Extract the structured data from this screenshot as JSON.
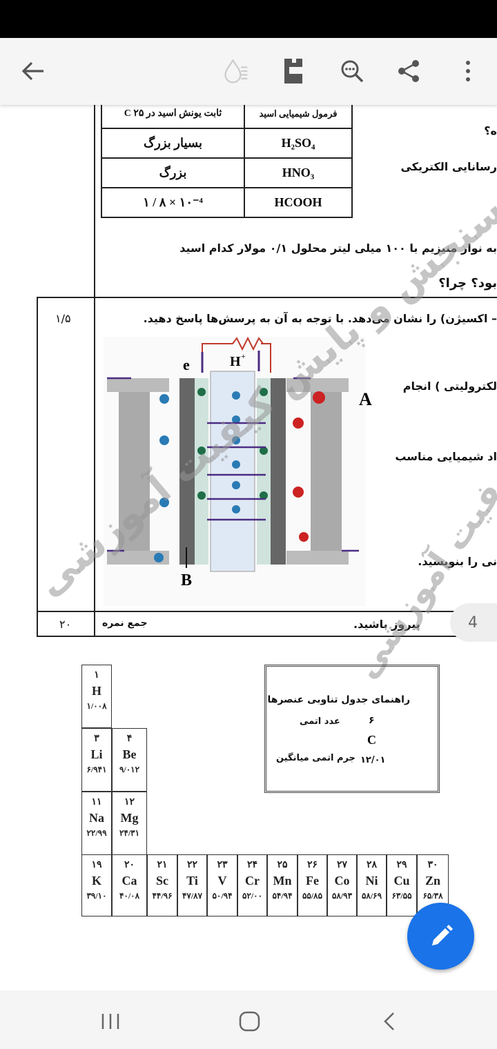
{
  "toolbar": {
    "icons": [
      "back-arrow-icon",
      "reading-mode-icon",
      "bookmark-icon",
      "search-zoom-icon",
      "share-icon",
      "more-icon"
    ]
  },
  "document": {
    "acid_table": {
      "headers": [
        "ثابت یونش اسید در 25°C",
        "فرمول شیمیایی اسید"
      ],
      "header_left": "ثابت یونش اسید در",
      "header_temp": "C ۲۵",
      "rows": [
        {
          "ka": "بسیار بزرگ",
          "formula": "H₂SO₄"
        },
        {
          "ka": "بزرگ",
          "formula": "HNO₃"
        },
        {
          "ka": "۱ / ۸ × ۱۰⁻⁴",
          "formula": "HCOOH"
        }
      ]
    },
    "fragments": {
      "q_mark": "ه؟",
      "conductivity": "رسانایی الکتریکی",
      "magnesium": "به نوار منیزیم با ۱۰۰ میلی لیتر محلول ۰/۱ مولار کدام اسید",
      "why": "بود؟ چرا؟",
      "fuel_cell_intro": "– اکسیژن) را نشان می‌دهد. با توجه به آن به پرسش‌ها پاسخ دهید.",
      "electrolyte": "لکترولیتی ) انجام",
      "chemical": "اد شیمیایی مناسب",
      "write": "نی را بنویسید.",
      "success": "پیروز باشید."
    },
    "score": "۱/۵",
    "total_score": "۲۰",
    "total_label": "جمع نمره",
    "diagram_labels": {
      "e": "e",
      "h": "H",
      "plus": "+",
      "a": "A",
      "b": "B"
    },
    "watermark": [
      "سنجش و پایش کیفیت آموزشی",
      "سنجش و پایش کیفیت آموزشی"
    ]
  },
  "periodic_guide": {
    "title": "راهنمای جدول تناوبی عنصرها",
    "atomic_number_label": "عدد اتمی",
    "atomic_number": "۶",
    "symbol": "C",
    "mass_label": "جرم اتمی میانگین",
    "mass": "۱۲/۰۱"
  },
  "periodic_table": [
    {
      "n": "۱",
      "s": "H",
      "m": "۱/۰۰۸"
    },
    {
      "n": "۳",
      "s": "Li",
      "m": "۶/۹۴۱"
    },
    {
      "n": "۴",
      "s": "Be",
      "m": "۹/۰۱۲"
    },
    {
      "n": "۱۱",
      "s": "Na",
      "m": "۲۲/۹۹"
    },
    {
      "n": "۱۲",
      "s": "Mg",
      "m": "۲۴/۳۱"
    },
    {
      "n": "۱۹",
      "s": "K",
      "m": "۳۹/۱۰"
    },
    {
      "n": "۲۰",
      "s": "Ca",
      "m": "۴۰/۰۸"
    },
    {
      "n": "۲۱",
      "s": "Sc",
      "m": "۴۴/۹۶"
    },
    {
      "n": "۲۲",
      "s": "Ti",
      "m": "۴۷/۸۷"
    },
    {
      "n": "۲۳",
      "s": "V",
      "m": "۵۰/۹۴"
    },
    {
      "n": "۲۴",
      "s": "Cr",
      "m": "۵۲/۰۰"
    },
    {
      "n": "۲۵",
      "s": "Mn",
      "m": "۵۴/۹۴"
    },
    {
      "n": "۲۶",
      "s": "Fe",
      "m": "۵۵/۸۵"
    },
    {
      "n": "۲۷",
      "s": "Co",
      "m": "۵۸/۹۳"
    },
    {
      "n": "۲۸",
      "s": "Ni",
      "m": "۵۸/۶۹"
    },
    {
      "n": "۲۹",
      "s": "Cu",
      "m": "۶۳/۵۵"
    },
    {
      "n": "۳۰",
      "s": "Zn",
      "m": "۶۵/۳۸"
    }
  ],
  "page_indicator": "4",
  "fab": {
    "icon": "edit-pencil-icon",
    "color": "#1a73e8"
  },
  "navbar": {
    "icons": [
      "recent-apps-icon",
      "home-icon",
      "back-icon"
    ]
  }
}
